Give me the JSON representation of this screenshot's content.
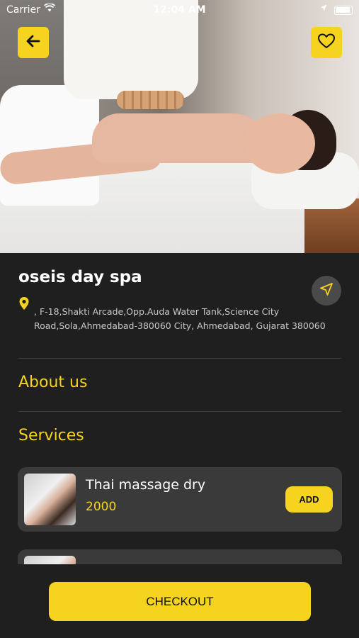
{
  "status_bar": {
    "carrier": "Carrier",
    "time": "12:04 AM"
  },
  "icons": {
    "back": "arrow-left-icon",
    "favorite": "heart-icon",
    "navigate": "navigation-arrow-icon",
    "location": "map-pin-icon"
  },
  "colors": {
    "accent": "#f6d31e",
    "background": "#1f1f1f",
    "card": "#3a3a3a"
  },
  "spa": {
    "name": "oseis day spa",
    "address": ", F-18,Shakti Arcade,Opp.Auda Water Tank,Science City Road,Sola,Ahmedabad-380060 City, Ahmedabad, Gujarat 380060"
  },
  "sections": {
    "about": "About us",
    "services": "Services"
  },
  "services": [
    {
      "name": "Thai massage dry",
      "price": "2000",
      "add_label": "ADD"
    }
  ],
  "checkout_label": "CHECKOUT"
}
